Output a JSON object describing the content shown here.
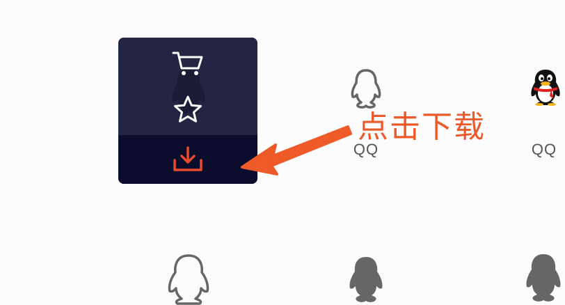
{
  "card": {
    "cart_icon": "cart-icon",
    "favorite_icon": "star-icon",
    "download_icon": "download-icon",
    "download_color": "#e84b2c"
  },
  "items": [
    {
      "label": "QQ",
      "icon": "qq-outline-icon"
    },
    {
      "label": "QQ",
      "icon": "qq-color-icon"
    }
  ],
  "annotation": {
    "text": "点击下载",
    "color": "#ec5a2b"
  }
}
